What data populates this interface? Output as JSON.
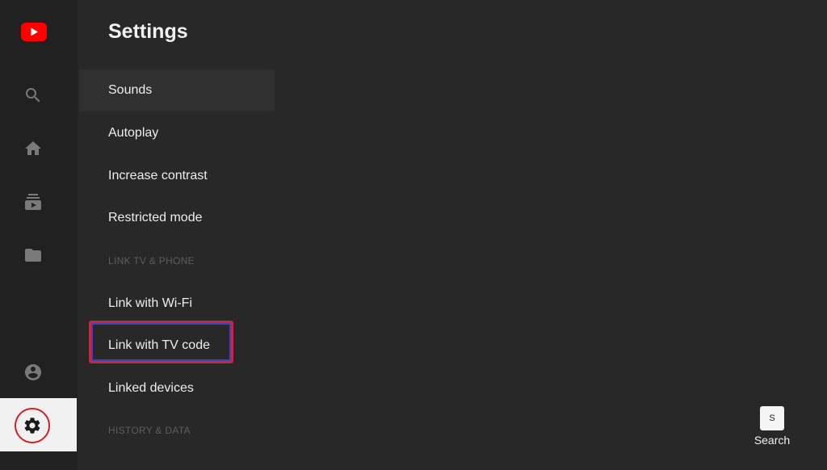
{
  "page": {
    "title": "Settings"
  },
  "rail": {
    "icons": [
      "youtube-logo-icon",
      "search-icon",
      "home-icon",
      "subscriptions-icon",
      "library-folder-icon",
      "account-icon",
      "gear-icon"
    ]
  },
  "menu": {
    "items": [
      {
        "label": "Sounds",
        "focused": true
      },
      {
        "label": "Autoplay"
      },
      {
        "label": "Increase contrast"
      },
      {
        "label": "Restricted mode"
      }
    ],
    "section_link": "LINK TV & PHONE",
    "link_items": [
      {
        "label": "Link with Wi-Fi"
      },
      {
        "label": "Link with TV code",
        "highlighted": true
      },
      {
        "label": "Linked devices"
      }
    ],
    "section_history": "HISTORY & DATA"
  },
  "hint": {
    "key": "S",
    "label": "Search"
  },
  "colors": {
    "background": "#282828",
    "rail": "#212121",
    "brand_red": "#ff0000",
    "highlight_outer": "#c5244b",
    "highlight_inner": "#3a46b8"
  }
}
